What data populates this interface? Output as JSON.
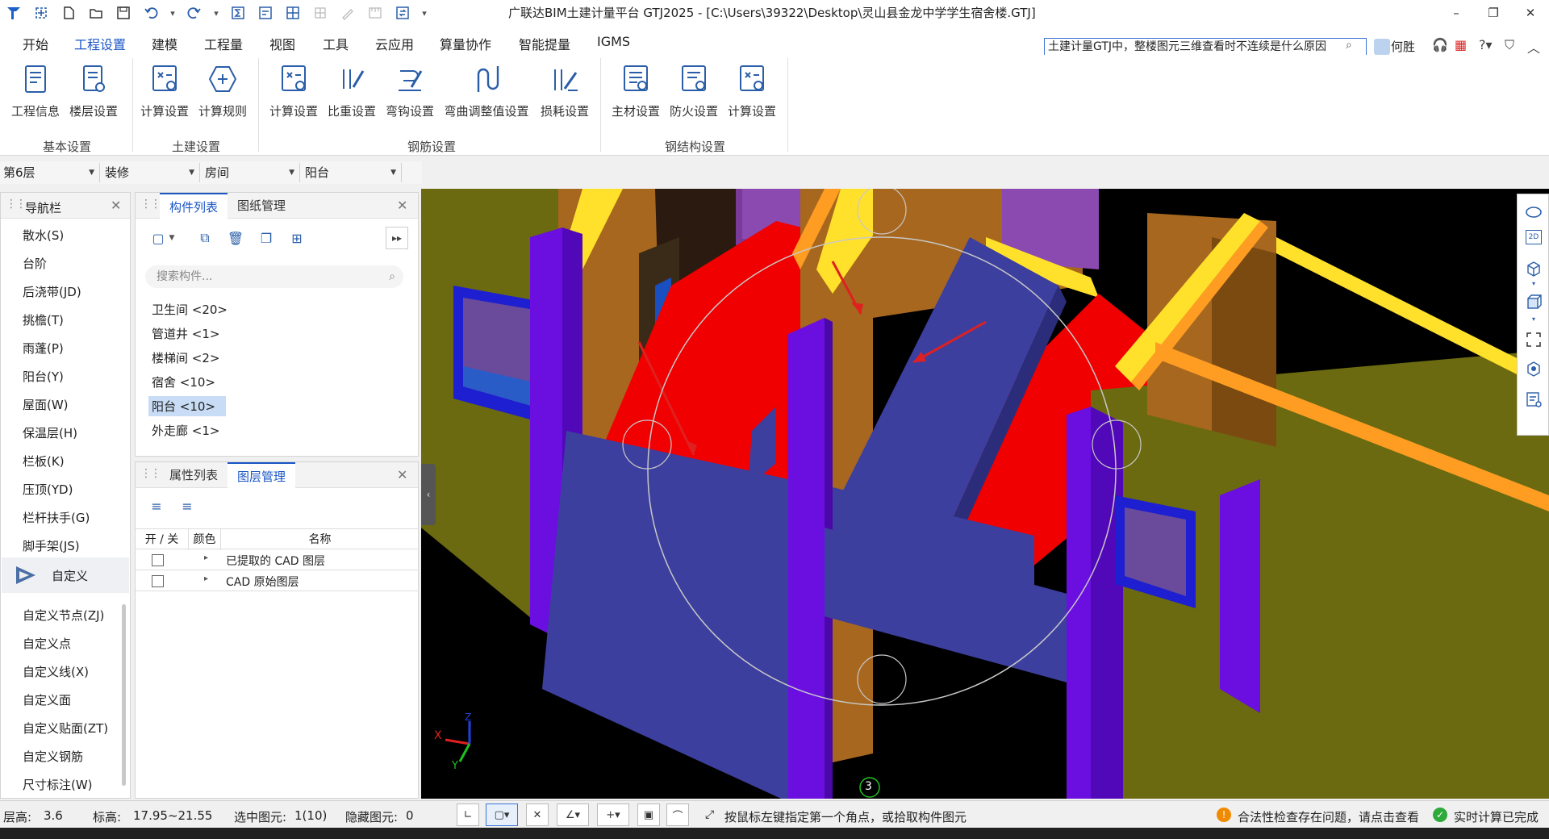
{
  "titlebar": {
    "title": "广联达BIM土建计量平台 GTJ2025 - [C:\\Users\\39322\\Desktop\\灵山县金龙中学学生宿舍楼.GTJ]",
    "quick_access_icons": [
      "app-logo-icon",
      "snap-icon",
      "new-file-icon",
      "open-folder-icon",
      "save-icon",
      "undo-icon",
      "redo-icon",
      "sum-icon",
      "calc-icon",
      "table-icon",
      "grid-icon",
      "edit-icon",
      "ruler-icon",
      "sync-icon",
      "more-icon"
    ]
  },
  "menu": {
    "items": [
      "开始",
      "工程设置",
      "建模",
      "工程量",
      "视图",
      "工具",
      "云应用",
      "算量协作",
      "智能提量",
      "IGMS"
    ],
    "active": "工程设置",
    "help_search_value": "土建计量GTJ中，整楼图元三维查看时不连续是什么原因",
    "user_name": "何胜"
  },
  "ribbon": {
    "groups": [
      {
        "label": "基本设置",
        "buttons": [
          "工程信息",
          "楼层设置"
        ]
      },
      {
        "label": "土建设置",
        "buttons": [
          "计算设置",
          "计算规则"
        ]
      },
      {
        "label": "钢筋设置",
        "buttons": [
          "计算设置",
          "比重设置",
          "弯钩设置",
          "弯曲调整值设置",
          "损耗设置"
        ]
      },
      {
        "label": "钢结构设置",
        "buttons": [
          "主材设置",
          "防火设置",
          "计算设置"
        ]
      }
    ]
  },
  "selectors": [
    "第6层",
    "装修",
    "房间",
    "阳台"
  ],
  "nav_panel": {
    "title": "导航栏",
    "items": [
      "散水(S)",
      "台阶",
      "后浇带(JD)",
      "挑檐(T)",
      "雨蓬(P)",
      "阳台(Y)",
      "屋面(W)",
      "保温层(H)",
      "栏板(K)",
      "压顶(YD)",
      "栏杆扶手(G)",
      "脚手架(JS)"
    ],
    "special": "自定义",
    "sub_items": [
      "自定义节点(ZJ)",
      "自定义点",
      "自定义线(X)",
      "自定义面",
      "自定义贴面(ZT)",
      "自定义钢筋",
      "尺寸标注(W)"
    ]
  },
  "component_panel": {
    "tabs": [
      "构件列表",
      "图纸管理"
    ],
    "active_tab": "构件列表",
    "search_placeholder": "搜索构件...",
    "items": [
      "卫生间 <20>",
      "管道井 <1>",
      "楼梯间 <2>",
      "宿舍 <10>",
      "阳台 <10>",
      "外走廊 <1>"
    ],
    "selected": "阳台 <10>"
  },
  "layer_panel": {
    "tabs": [
      "属性列表",
      "图层管理"
    ],
    "active_tab": "图层管理",
    "columns": [
      "开 / 关",
      "颜色",
      "名称"
    ],
    "rows": [
      {
        "on": false,
        "name": "已提取的 CAD 图层"
      },
      {
        "on": false,
        "name": "CAD 原始图层"
      }
    ]
  },
  "viewport": {
    "axis_label_number": "3",
    "axis_x": "X",
    "axis_y": "Y",
    "axis_z": "Z",
    "toolbar_icons": [
      "orbit-icon",
      "2d-icon",
      "cube-icon",
      "box-icon",
      "fullscreen-icon",
      "3d-view-icon",
      "list-settings-icon"
    ]
  },
  "statusbar": {
    "floor_height_label": "层高:",
    "floor_height_value": "3.6",
    "elevation_label": "标高:",
    "elevation_value": "17.95~21.55",
    "selected_label": "选中图元:",
    "selected_value": "1(10)",
    "hidden_label": "隐藏图元:",
    "hidden_value": "0",
    "hint": "按鼠标左键指定第一个角点，或拾取构件图元",
    "warning": "合法性检查存在问题，请点击查看",
    "status": "实时计算已完成"
  },
  "colors": {
    "accent": "#1a56c6",
    "wall_orange": "#b36b1f",
    "floor_red": "#f00000",
    "column_purple": "#6a0fe0",
    "beam_blue": "#3d3f9e",
    "rail_yellow": "#ffe12b"
  }
}
